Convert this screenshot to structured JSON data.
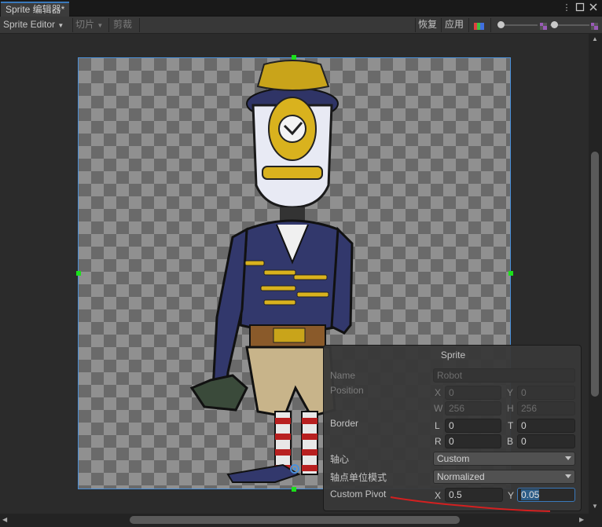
{
  "window": {
    "tab_title": "Sprite 编辑器*",
    "menu_icon": "kebab-menu-icon",
    "maximize_icon": "maximize-icon",
    "close_icon": "close-icon"
  },
  "toolbar": {
    "mode_label": "Sprite Editor",
    "slice_label": "切片",
    "trim_label": "剪裁",
    "revert_label": "恢复",
    "apply_label": "应用",
    "color_channel_icon": "rgb-channel-icon",
    "zoom_icons": [
      "zoom-out-icon",
      "zoom-in-icon"
    ]
  },
  "panel": {
    "title": "Sprite",
    "name_label": "Name",
    "name_value": "Robot",
    "position_label": "Position",
    "pos_x_label": "X",
    "pos_x_value": "0",
    "pos_y_label": "Y",
    "pos_y_value": "0",
    "pos_w_label": "W",
    "pos_w_value": "256",
    "pos_h_label": "H",
    "pos_h_value": "256",
    "border_label": "Border",
    "border_l_label": "L",
    "border_l_value": "0",
    "border_t_label": "T",
    "border_t_value": "0",
    "border_r_label": "R",
    "border_r_value": "0",
    "border_b_label": "B",
    "border_b_value": "0",
    "pivot_label": "轴心",
    "pivot_value": "Custom",
    "pivot_unit_label": "轴点单位模式",
    "pivot_unit_value": "Normalized",
    "custom_pivot_label": "Custom Pivot",
    "cp_x_label": "X",
    "cp_x_value": "0.5",
    "cp_y_label": "Y",
    "cp_y_value": "0.05"
  },
  "colors": {
    "accent": "#3a79bb",
    "handle": "#1be01b",
    "annotation": "#d42020"
  }
}
